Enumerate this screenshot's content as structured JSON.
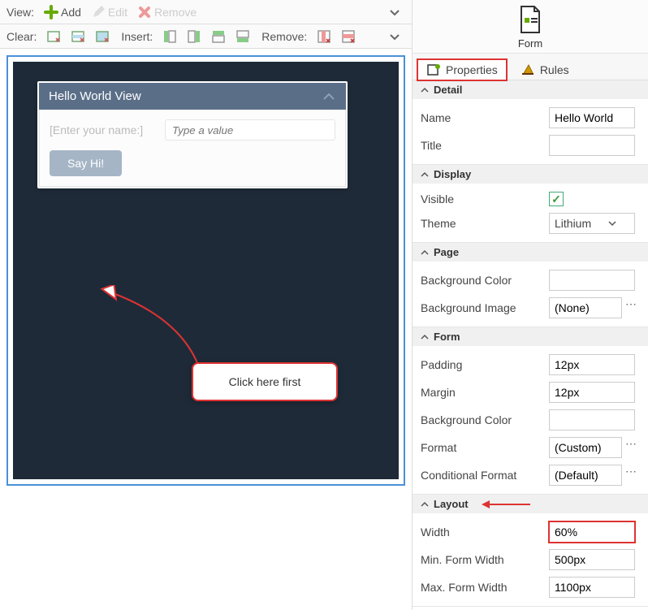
{
  "toolbar1": {
    "view_label": "View:",
    "add": "Add",
    "edit": "Edit",
    "remove": "Remove"
  },
  "toolbar2": {
    "clear_label": "Clear:",
    "insert_label": "Insert:",
    "remove_label": "Remove:"
  },
  "canvas": {
    "view_title": "Hello World View",
    "field_label": "[Enter your name:]",
    "field_placeholder": "Type a value",
    "button_label": "Say Hi!"
  },
  "callout_text": "Click here first",
  "right": {
    "header_label": "Form",
    "tabs": {
      "properties": "Properties",
      "rules": "Rules"
    },
    "sections": {
      "detail": {
        "title": "Detail",
        "name_label": "Name",
        "name_value": "Hello World",
        "title_label": "Title",
        "title_value": ""
      },
      "display": {
        "title": "Display",
        "visible_label": "Visible",
        "visible_value": true,
        "theme_label": "Theme",
        "theme_value": "Lithium"
      },
      "page": {
        "title": "Page",
        "bgcolor_label": "Background Color",
        "bgcolor_value": "",
        "bgimage_label": "Background Image",
        "bgimage_value": "(None)"
      },
      "form": {
        "title": "Form",
        "padding_label": "Padding",
        "padding_value": "12px",
        "margin_label": "Margin",
        "margin_value": "12px",
        "bgcolor_label": "Background Color",
        "bgcolor_value": "",
        "format_label": "Format",
        "format_value": "(Custom)",
        "condfmt_label": "Conditional Format",
        "condfmt_value": "(Default)"
      },
      "layout": {
        "title": "Layout",
        "width_label": "Width",
        "width_value": "60%",
        "minw_label": "Min. Form Width",
        "minw_value": "500px",
        "maxw_label": "Max. Form Width",
        "maxw_value": "1100px"
      }
    }
  }
}
